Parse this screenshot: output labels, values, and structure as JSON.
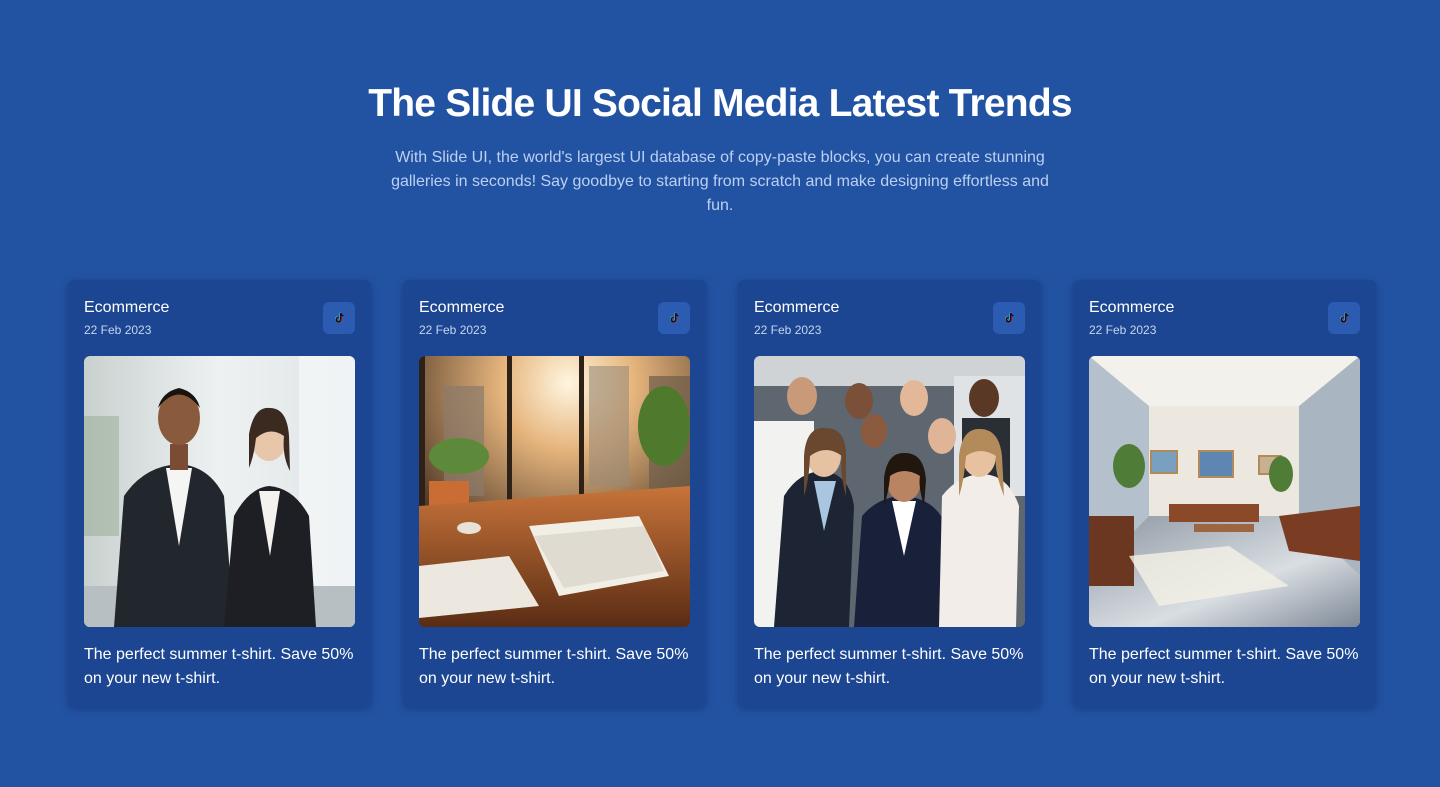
{
  "hero": {
    "title": "The Slide UI Social Media Latest Trends",
    "description": "With Slide UI, the world's largest UI database of copy-paste blocks, you can create stunning galleries in seconds! Say goodbye to starting from scratch and make designing effortless and fun."
  },
  "cards": [
    {
      "category": "Ecommerce",
      "date": "22 Feb 2023",
      "icon": "tiktok-icon",
      "image": "two-business-people-photo",
      "text": "The perfect summer t-shirt. Save 50% on your new t-shirt."
    },
    {
      "category": "Ecommerce",
      "date": "22 Feb 2023",
      "icon": "tiktok-icon",
      "image": "sunlit-office-desk-photo",
      "text": "The perfect summer t-shirt. Save 50% on your new t-shirt."
    },
    {
      "category": "Ecommerce",
      "date": "22 Feb 2023",
      "icon": "tiktok-icon",
      "image": "business-team-group-photo",
      "text": "The perfect summer t-shirt. Save 50% on your new t-shirt."
    },
    {
      "category": "Ecommerce",
      "date": "22 Feb 2023",
      "icon": "tiktok-icon",
      "image": "office-lounge-interior-photo",
      "text": "The perfect summer t-shirt. Save 50% on your new t-shirt."
    }
  ],
  "colors": {
    "background": "#2253a3",
    "card": "#1c4691",
    "icon_button": "#2b5cb2",
    "subtitle": "#bcd0f2"
  }
}
